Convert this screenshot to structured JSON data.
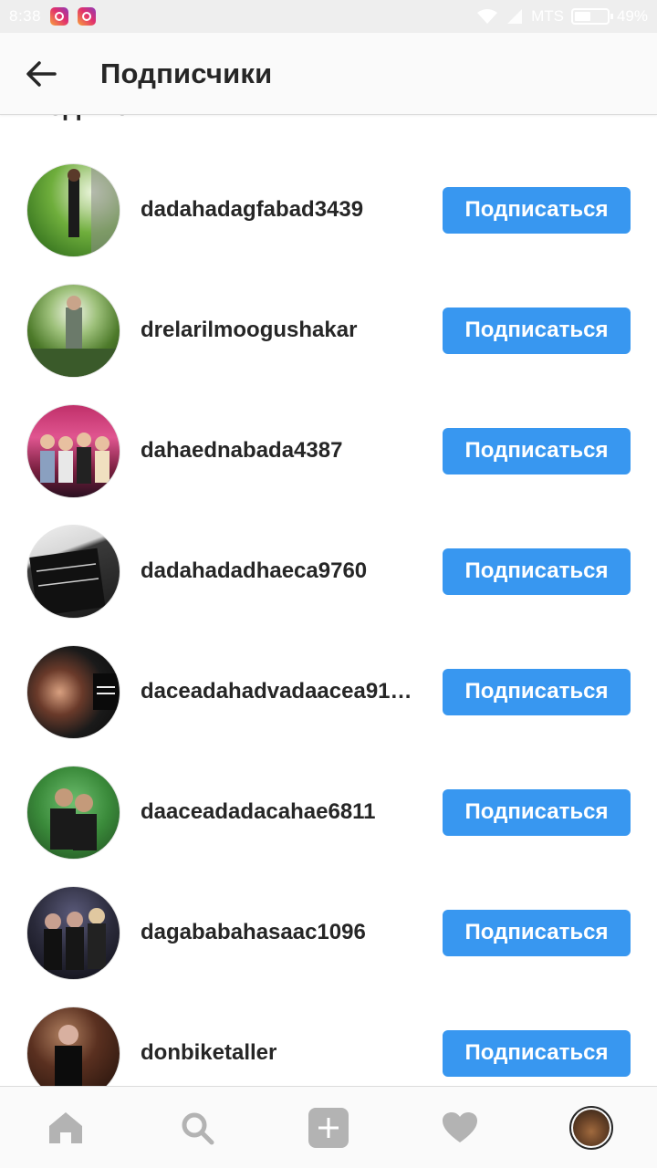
{
  "status_bar": {
    "time": "8:38",
    "carrier": "MTS",
    "battery_percent": "49%",
    "battery_level": 0.49,
    "notification_icons": [
      "instagram-icon",
      "instagram-icon"
    ]
  },
  "header": {
    "title": "Подписчики",
    "back_icon": "arrow-left-icon"
  },
  "section_heading_peek": "Подписчики",
  "followers": [
    {
      "username": "dadahadagfabad3439",
      "button_label": "Подписаться"
    },
    {
      "username": "drelarilmoogushakar",
      "button_label": "Подписаться"
    },
    {
      "username": "dahaednabada4387",
      "button_label": "Подписаться"
    },
    {
      "username": "dadahadadhaeca9760",
      "button_label": "Подписаться"
    },
    {
      "username": "daceadahadvadaacea91…",
      "button_label": "Подписаться"
    },
    {
      "username": "daaceadadacahae6811",
      "button_label": "Подписаться"
    },
    {
      "username": "dagababahasaac1096",
      "button_label": "Подписаться"
    },
    {
      "username": "donbiketaller",
      "button_label": "Подписаться"
    }
  ],
  "bottom_nav": {
    "items": [
      "home-icon",
      "search-icon",
      "add-post-icon",
      "heart-icon",
      "profile-avatar"
    ]
  },
  "colors": {
    "accent": "#3897f0",
    "text": "#262626",
    "icon_inactive": "#b3b3b3"
  }
}
